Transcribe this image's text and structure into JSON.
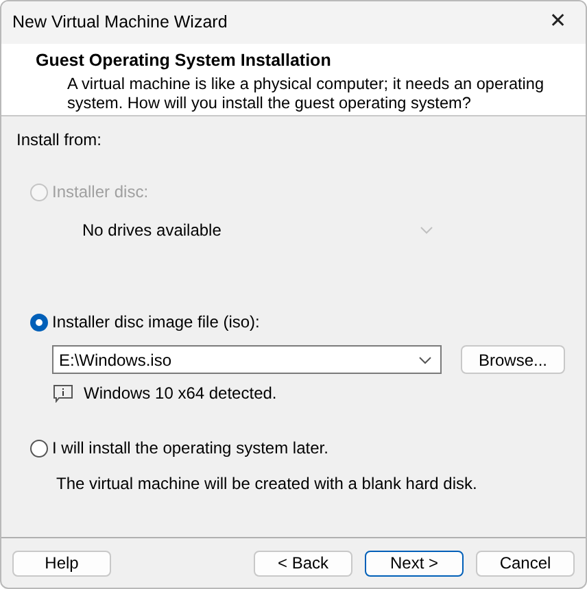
{
  "window": {
    "title": "New Virtual Machine Wizard",
    "close": "✕"
  },
  "header": {
    "title": "Guest Operating System Installation",
    "description": "A virtual machine is like a physical computer; it needs an operating system. How will you install the guest operating system?"
  },
  "install_from_label": "Install from:",
  "options": [
    {
      "kind": "disc",
      "label": "Installer disc:",
      "selected": false,
      "disabled": true,
      "value": "No drives available"
    },
    {
      "kind": "iso",
      "label": "Installer disc image file (iso):",
      "selected": true,
      "disabled": false,
      "value": "E:\\Windows.iso",
      "browse": "Browse...",
      "note": "Windows 10 x64 detected."
    },
    {
      "kind": "later",
      "label": "I will install the operating system later.",
      "selected": false,
      "disabled": false,
      "note": "The virtual machine will be created with a blank hard disk."
    }
  ],
  "buttons": [
    {
      "label": "Help",
      "default": false
    },
    {
      "label": "< Back",
      "default": false
    },
    {
      "label": "Next >",
      "default": true
    },
    {
      "label": "Cancel",
      "default": false
    }
  ]
}
